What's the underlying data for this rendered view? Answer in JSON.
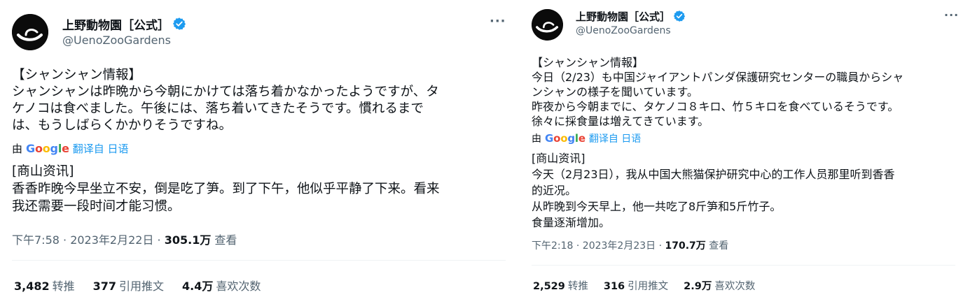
{
  "tweets": [
    {
      "display_name": "上野動物園［公式］",
      "handle": "@UenoZooGardens",
      "original_lines": [
        "【シャンシャン情報】",
        "シャンシャンは昨晩から今朝にかけては落ち着かなかったようですが、タ",
        "ケノコは食べました。午後には、落ち着いてきたそうです。慣れるまで",
        "は、もうしばらくかかりそうですね。"
      ],
      "translate": {
        "by_label": "由",
        "google_label": "Google",
        "link_label": "翻译自 日语"
      },
      "translated_lines": [
        "[商山资讯]",
        "香香昨晚今早坐立不安，倒是吃了笋。到了下午，他似乎平静了下来。看来",
        "我还需要一段时间才能习惯。"
      ],
      "meta": {
        "time": "下午7:58 · 2023年2月22日 · ",
        "views_count": "305.1万",
        "views_label": " 查看"
      },
      "stats": {
        "retweets_count": "3,482",
        "retweets_label": "转推",
        "quotes_count": "377",
        "quotes_label": "引用推文",
        "likes_count": "4.4万",
        "likes_label": "喜欢次数"
      }
    },
    {
      "display_name": "上野動物園［公式］",
      "handle": "@UenoZooGardens",
      "original_lines": [
        "【シャンシャン情報】",
        "今日（2/23）も中国ジャイアントパンダ保護研究センターの職員からシャ",
        "ンシャンの様子を聞いています。",
        "昨夜から今朝までに、タケノコ８キロ、竹５キロを食べているそうです。",
        "徐々に採食量は増えてきています。"
      ],
      "translate": {
        "by_label": "由",
        "google_label": "Google",
        "link_label": "翻译自 日语"
      },
      "translated_lines": [
        "[商山资讯]",
        "今天（2月23日），我从中国大熊猫保护研究中心的工作人员那里听到香香",
        "的近况。",
        "从昨晚到今天早上，他一共吃了8斤笋和5斤竹子。",
        "食量逐渐增加。"
      ],
      "meta": {
        "time": "下午2:18 · 2023年2月23日 · ",
        "views_count": "170.7万",
        "views_label": " 查看"
      },
      "stats": {
        "retweets_count": "2,529",
        "retweets_label": "转推",
        "quotes_count": "316",
        "quotes_label": "引用推文",
        "likes_count": "2.9万",
        "likes_label": "喜欢次数"
      }
    }
  ],
  "colors": {
    "text_primary": "#0f1419",
    "text_secondary": "#536471",
    "link_blue": "#1d9bf0",
    "verified_blue": "#1d9bf0",
    "divider": "#eff3f4",
    "avatar_bg": "#0b0b0b"
  }
}
